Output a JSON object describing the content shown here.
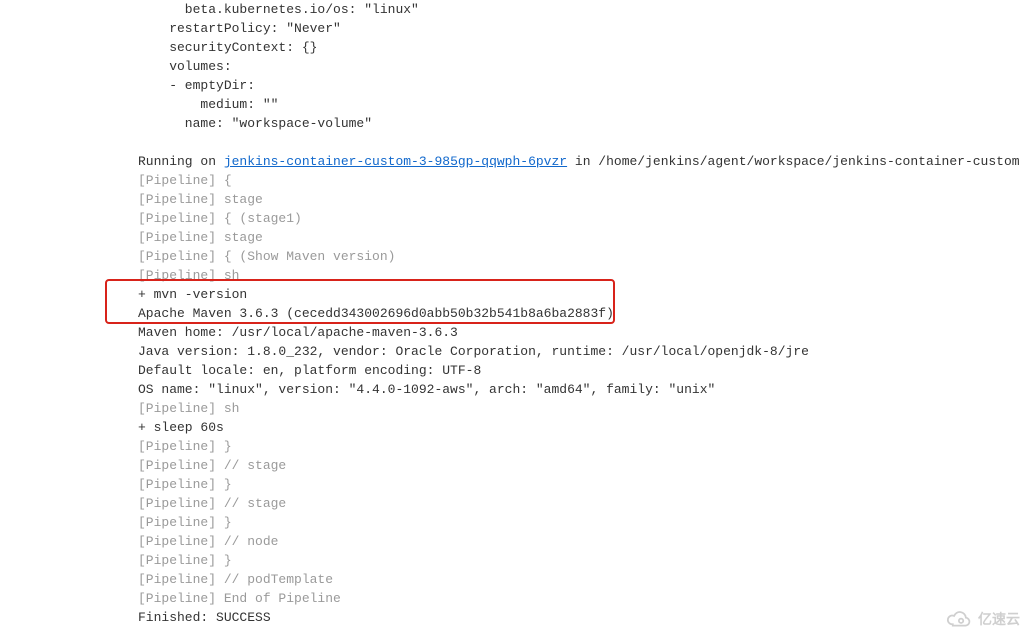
{
  "console": {
    "lines": [
      {
        "cls": "black",
        "text": "      beta.kubernetes.io/os: \"linux\""
      },
      {
        "cls": "black",
        "text": "    restartPolicy: \"Never\""
      },
      {
        "cls": "black",
        "text": "    securityContext: {}"
      },
      {
        "cls": "black",
        "text": "    volumes:"
      },
      {
        "cls": "black",
        "text": "    - emptyDir:"
      },
      {
        "cls": "black",
        "text": "        medium: \"\""
      },
      {
        "cls": "black",
        "text": "      name: \"workspace-volume\""
      },
      {
        "cls": "black",
        "text": ""
      },
      {
        "cls": "mixed",
        "pre": "Running on ",
        "link": "jenkins-container-custom-3-985gp-qqwph-6pvzr",
        "post": " in /home/jenkins/agent/workspace/jenkins-container-custom"
      },
      {
        "cls": "gray",
        "text": "[Pipeline] {"
      },
      {
        "cls": "gray",
        "text": "[Pipeline] stage"
      },
      {
        "cls": "gray",
        "text": "[Pipeline] { (stage1)"
      },
      {
        "cls": "gray",
        "text": "[Pipeline] stage"
      },
      {
        "cls": "gray",
        "text": "[Pipeline] { (Show Maven version)"
      },
      {
        "cls": "gray",
        "text": "[Pipeline] sh"
      },
      {
        "cls": "black",
        "text": "+ mvn -version"
      },
      {
        "cls": "black",
        "text": "Apache Maven 3.6.3 (cecedd343002696d0abb50b32b541b8a6ba2883f)"
      },
      {
        "cls": "black",
        "text": "Maven home: /usr/local/apache-maven-3.6.3"
      },
      {
        "cls": "black",
        "text": "Java version: 1.8.0_232, vendor: Oracle Corporation, runtime: /usr/local/openjdk-8/jre"
      },
      {
        "cls": "black",
        "text": "Default locale: en, platform encoding: UTF-8"
      },
      {
        "cls": "black",
        "text": "OS name: \"linux\", version: \"4.4.0-1092-aws\", arch: \"amd64\", family: \"unix\""
      },
      {
        "cls": "gray",
        "text": "[Pipeline] sh"
      },
      {
        "cls": "black",
        "text": "+ sleep 60s"
      },
      {
        "cls": "gray",
        "text": "[Pipeline] }"
      },
      {
        "cls": "gray",
        "text": "[Pipeline] // stage"
      },
      {
        "cls": "gray",
        "text": "[Pipeline] }"
      },
      {
        "cls": "gray",
        "text": "[Pipeline] // stage"
      },
      {
        "cls": "gray",
        "text": "[Pipeline] }"
      },
      {
        "cls": "gray",
        "text": "[Pipeline] // node"
      },
      {
        "cls": "gray",
        "text": "[Pipeline] }"
      },
      {
        "cls": "gray",
        "text": "[Pipeline] // podTemplate"
      },
      {
        "cls": "gray",
        "text": "[Pipeline] End of Pipeline"
      },
      {
        "cls": "black",
        "text": "Finished: SUCCESS"
      }
    ]
  },
  "watermark": {
    "text": "亿速云"
  }
}
